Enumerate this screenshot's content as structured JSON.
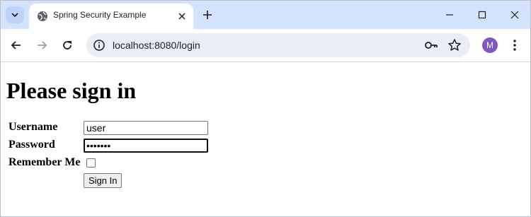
{
  "browser": {
    "tab": {
      "title": "Spring Security Example"
    },
    "address_bar": {
      "url": "localhost:8080/login"
    },
    "profile": {
      "initial": "M",
      "color": "#7e57c2"
    }
  },
  "page": {
    "title": "Please sign in",
    "username": {
      "label": "Username",
      "value": "user"
    },
    "password": {
      "label": "Password",
      "value": "•••••••"
    },
    "remember_me": {
      "label": "Remember Me",
      "checked": false
    },
    "submit_label": "Sign In"
  }
}
